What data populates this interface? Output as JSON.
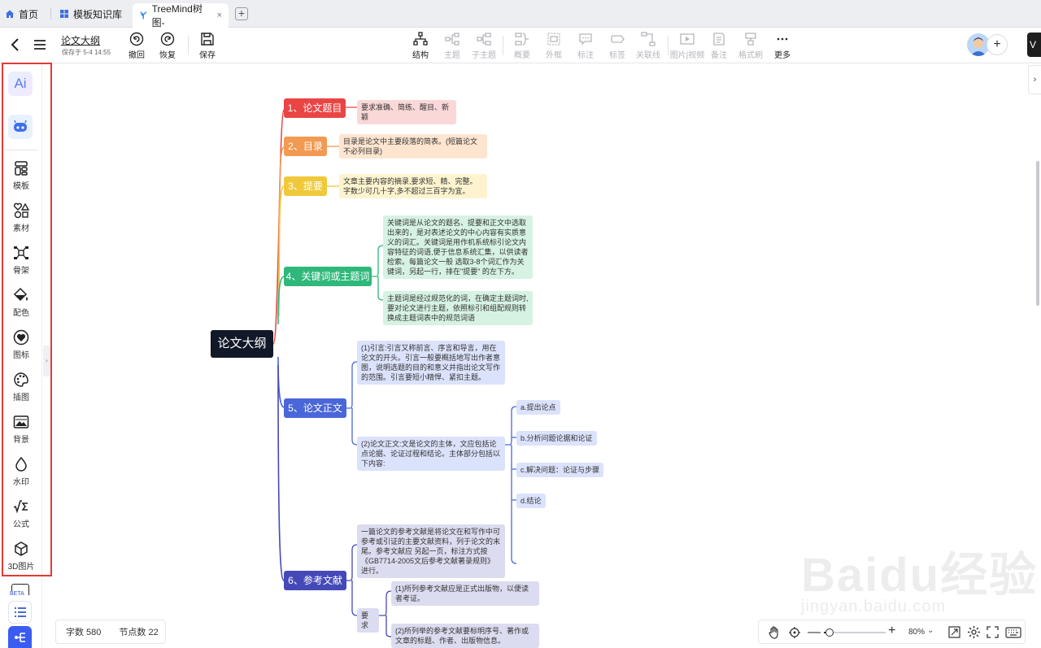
{
  "tabs": [
    {
      "label": "首页"
    },
    {
      "label": "模板知识库"
    },
    {
      "label": "TreeMind树图-"
    }
  ],
  "toolbar": {
    "doc_title": "论文大纲",
    "saved_at": "保存于 5-4 14:55",
    "undo": "撤回",
    "redo": "恢复",
    "save": "保存",
    "structure": "结构",
    "topic": "主题",
    "subtopic": "子主题",
    "summary": "概要",
    "frame": "外框",
    "note_label": "标注",
    "tag": "标签",
    "relation": "关联线",
    "media": "图片|视频",
    "memo": "备注",
    "format_brush": "格式刷",
    "more": "更多"
  },
  "sidebar": {
    "ai_label": "Ai",
    "items": [
      {
        "label": "模板"
      },
      {
        "label": "素材"
      },
      {
        "label": "骨架"
      },
      {
        "label": "配色"
      },
      {
        "label": "图标"
      },
      {
        "label": "插图"
      },
      {
        "label": "背景"
      },
      {
        "label": "水印"
      },
      {
        "label": "公式"
      },
      {
        "label": "3D图片"
      }
    ],
    "beta": "BETA"
  },
  "mindmap": {
    "root": "论文大纲",
    "b1": {
      "title": "1、论文题目",
      "note": "要求准确、简练、醒目、新颖"
    },
    "b2": {
      "title": "2、目录",
      "note": "目录是论文中主要段落的简表。(短篇论文不必列目录)"
    },
    "b3": {
      "title": "3、提要",
      "note": "文章主要内容的摘录,要求短、精、完整。字数少可几十字,多不超过三百字为宜。"
    },
    "b4": {
      "title": "4、关键词或主题词",
      "note1": "关键词是从论文的题名、提要和正文中选取出来的，是对表述论文的中心内容有实质意义的词汇。关键词是用作机系统标引论文内容特征的词语,便于信息系统汇集，以供读者检索。每篇论文一般 选取3-8个词汇作为关键词，另起一行，排在\"提要\" 的左下方。",
      "note2": "主题词是经过规范化的词，在确定主题词时,要对论文进行主题，依照标引和组配规则转换成主题词表中的规范词语"
    },
    "b5": {
      "title": "5、论文正文",
      "note1": "(1)引言:引言又称前言、序言和导言，用在论文的开头。引言一般要概括地写出作者意图，说明选题的目的和意义并指出论文写作的范围。引言要短小精悍、紧扣主题。",
      "note2": "(2)论文正文:文是论文的主体，文应包括论点论据、论证过程和结论。主体部分包括以下内容:",
      "sub": [
        "a.提出论点",
        "b.分析问题论据和论证",
        "c.解决问题：论证与步骤",
        "d.结论"
      ]
    },
    "b6": {
      "title": "6、参考文献",
      "note1": "一篇论文的参考文献是将论文在和写作中可参考或引证的主要文献资料，列于论文的末尾。参考文献应 另起一页，标注方式按《GB7714-2005文后参考文献著录规则》进行。",
      "req": "要求",
      "req1": "(1)所列参考文献应是正式出版物，以便读者考证。",
      "req2": "(2)所列举的参考文献要标明序号、著作或文章的标题、作者、出版物信息。"
    }
  },
  "status": {
    "words": "字数 580",
    "nodes": "节点数 22"
  },
  "zoom": {
    "level": "80%"
  },
  "watermark": {
    "main": "Baidu经验",
    "sub": "jingyan.baidu.com"
  },
  "user": {
    "badge": "V"
  }
}
